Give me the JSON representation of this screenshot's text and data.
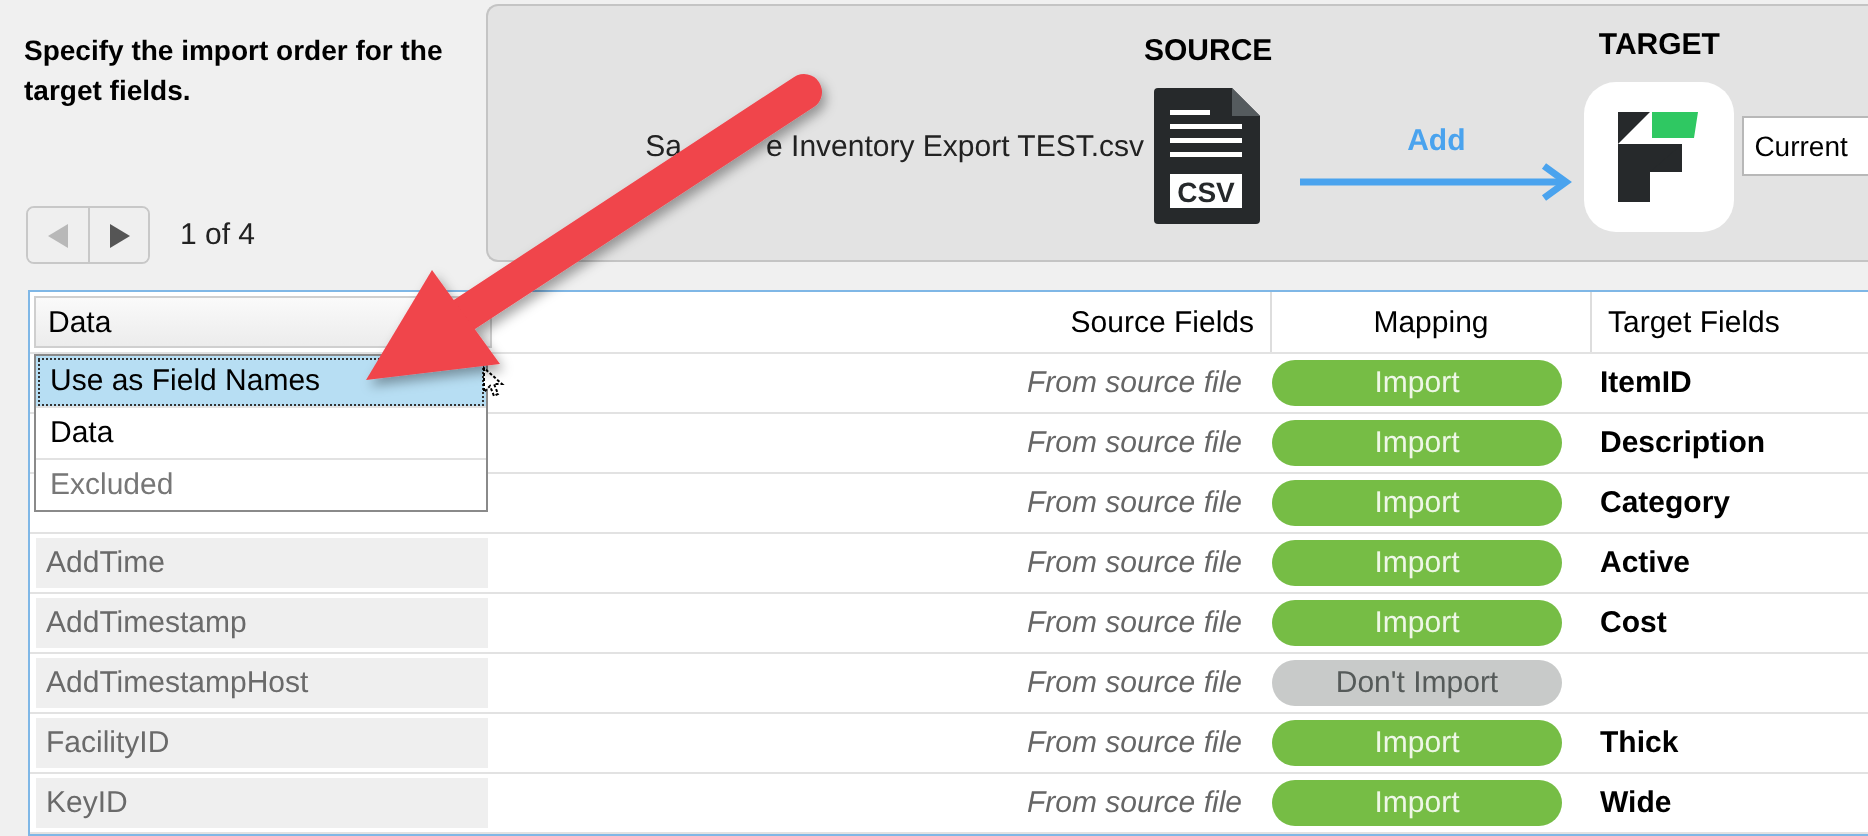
{
  "instruction": "Specify the import order for the target fields.",
  "pager": {
    "prev": {
      "disabled": true
    },
    "next": {
      "disabled": false
    },
    "text": "1 of 4"
  },
  "source": {
    "heading": "SOURCE",
    "file_name": [
      "Sa",
      "e Inventory Export TEST.csv"
    ],
    "icon_label": "CSV"
  },
  "action": "Add",
  "target": {
    "heading": "TARGET",
    "field_value": "Current"
  },
  "table": {
    "columns": [
      "Data",
      "Source Fields",
      "Mapping",
      "Target Fields"
    ],
    "rows": [
      {
        "source": "From source file",
        "mapping": {
          "label": "Import",
          "on": true
        },
        "target": "ItemID"
      },
      {
        "source": "From source file",
        "mapping": {
          "label": "Import",
          "on": true
        },
        "target": "Description"
      },
      {
        "source": "From source file",
        "mapping": {
          "label": "Import",
          "on": true
        },
        "target": "Category"
      },
      {
        "data": "AddTime",
        "source": "From source file",
        "mapping": {
          "label": "Import",
          "on": true
        },
        "target": "Active"
      },
      {
        "data": "AddTimestamp",
        "source": "From source file",
        "mapping": {
          "label": "Import",
          "on": true
        },
        "target": "Cost"
      },
      {
        "data": "AddTimestampHost",
        "source": "From source file",
        "mapping": {
          "label": "Don't Import",
          "on": false
        }
      },
      {
        "data": "FacilityID",
        "source": "From source file",
        "mapping": {
          "label": "Import",
          "on": true
        },
        "target": "Thick"
      },
      {
        "data": "KeyID",
        "source": "From source file",
        "mapping": {
          "label": "Import",
          "on": true
        },
        "target": "Wide"
      }
    ]
  },
  "dropdown": {
    "options": [
      {
        "label": "Use as Field Names",
        "selected": true,
        "disabled": false
      },
      {
        "label": "Data",
        "selected": false,
        "disabled": false
      },
      {
        "label": "Excluded",
        "selected": false,
        "disabled": true
      }
    ]
  }
}
